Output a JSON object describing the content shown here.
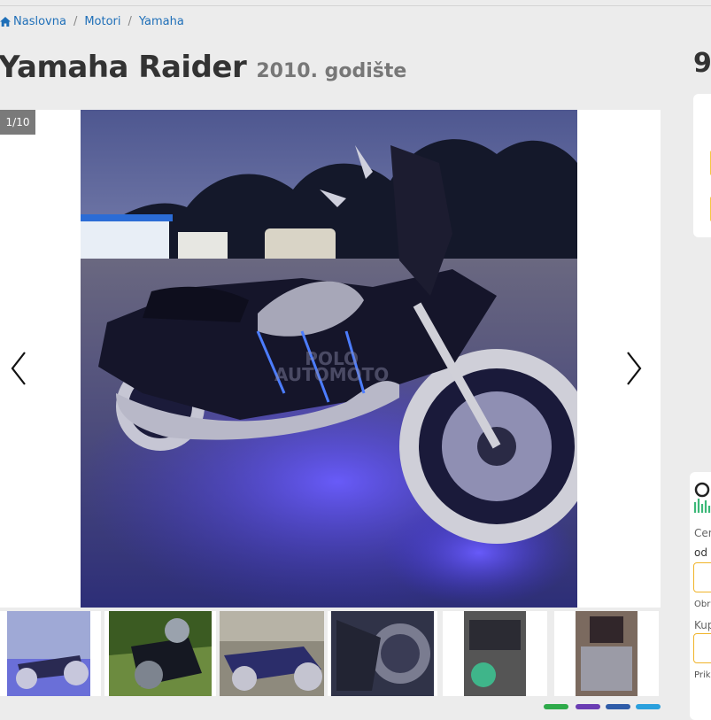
{
  "breadcrumb": {
    "items": [
      "Naslovna",
      "Motori",
      "Yamaha"
    ],
    "separator": "/"
  },
  "listing": {
    "title": "Yamaha Raider",
    "year_label": "2010. godište",
    "price_peek": "9"
  },
  "gallery": {
    "counter": "1/10",
    "watermark_line1": "POLO",
    "watermark_line2": "AUTOMOTO"
  },
  "sidebar": {
    "price_label": "Cen",
    "from_label": "od",
    "label_obra": "Obra",
    "label_kup": "Kup",
    "label_prik": "Prika"
  },
  "colors": {
    "link": "#1f6fb8",
    "accent": "#f0b429",
    "logo_green": "#3cb878"
  },
  "icons": [
    "home-icon",
    "chevron-left-icon",
    "chevron-right-icon"
  ]
}
